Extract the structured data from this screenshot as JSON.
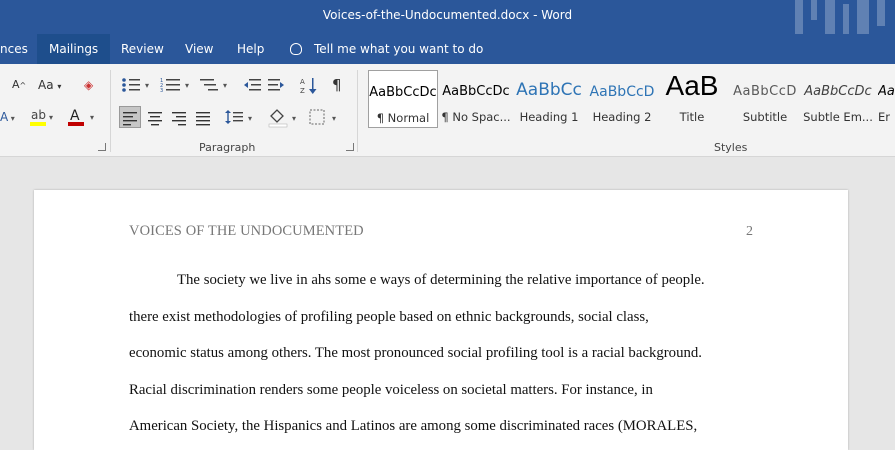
{
  "window": {
    "title": "Voices-of-the-Undocumented.docx  -  Word"
  },
  "tabs": [
    "nces",
    "Mailings",
    "Review",
    "View",
    "Help"
  ],
  "tell_me": "Tell me what you want to do",
  "ribbon": {
    "paragraph_label": "Paragraph",
    "styles_label": "Styles",
    "font_size_label": "Aa",
    "font_grow_label": "A",
    "styles": [
      {
        "preview": "AaBbCcDc",
        "name": "¶ Normal"
      },
      {
        "preview": "AaBbCcDc",
        "name": "¶ No Spac..."
      },
      {
        "preview": "AaBbCc",
        "name": "Heading 1"
      },
      {
        "preview": "AaBbCcD",
        "name": "Heading 2"
      },
      {
        "preview": "AaB",
        "name": "Title"
      },
      {
        "preview": "AaBbCcD",
        "name": "Subtitle"
      },
      {
        "preview": "AaBbCcDc",
        "name": "Subtle Em..."
      },
      {
        "preview": "Aa",
        "name": "Er"
      }
    ]
  },
  "document": {
    "header": "VOICES OF THE UNDOCUMENTED",
    "page_number": "2",
    "lines": [
      "The society we live in ahs some e ways of determining the relative importance of people.",
      "there exist methodologies of profiling people based on ethnic backgrounds, social class,",
      "economic status among others. The most pronounced social profiling tool is a racial background.",
      "Racial discrimination renders some people voiceless on societal matters. For instance, in",
      "American Society, the Hispanics and Latinos are among some discriminated races (MORALES,"
    ]
  },
  "colors": {
    "accent": "#2b579a",
    "ribbon": "#f3f3f3",
    "canvas": "#e6e6e6"
  }
}
